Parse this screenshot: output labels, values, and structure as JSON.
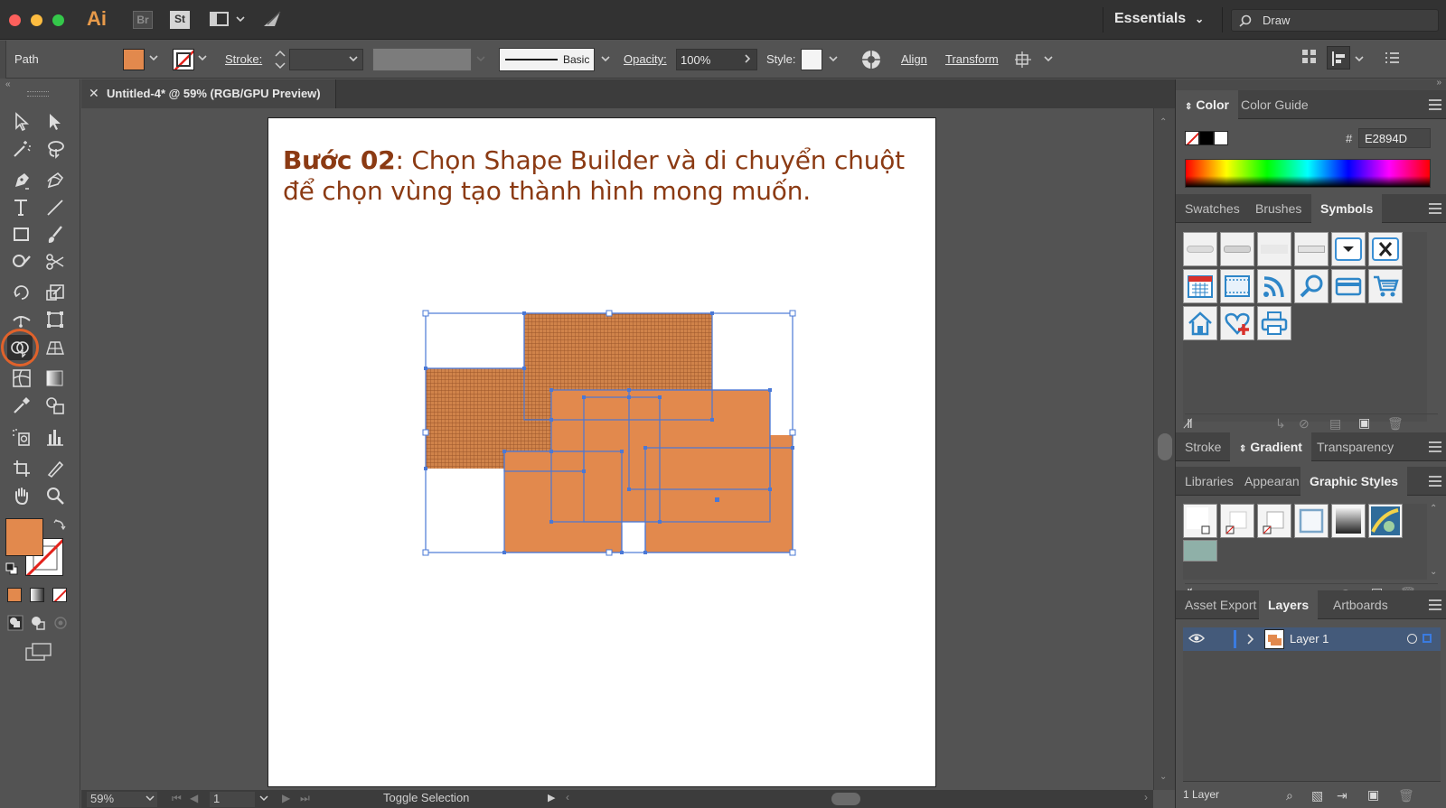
{
  "app": {
    "logo": "Ai",
    "bridge": "Br",
    "stock": "St",
    "workspace": "Essentials",
    "search_placeholder": "Draw"
  },
  "controlbar": {
    "selection_type": "Path",
    "fill_color": "#E2894D",
    "stroke_label": "Stroke:",
    "brush_label": "Basic",
    "opacity_label": "Opacity:",
    "opacity_value": "100%",
    "style_label": "Style:",
    "align_label": "Align",
    "transform_label": "Transform"
  },
  "document": {
    "tab_title": "Untitled-4* @ 59% (RGB/GPU Preview)",
    "heading_bold": "Bước 02",
    "heading_rest": ": Chọn Shape Builder và di chuyển chuột để chọn vùng tạo thành hình mong muốn.",
    "shape_color": "#E2894D",
    "selection_color": "#4a78d6"
  },
  "statusbar": {
    "zoom": "59%",
    "artboard_number": "1",
    "status_text": "Toggle Selection"
  },
  "tools": {
    "active_tool": "shape-builder",
    "highlight_color": "#e0622b"
  },
  "panels": {
    "color": {
      "tabs": [
        "Color",
        "Color Guide"
      ],
      "hex_prefix": "#",
      "hex_value": "E2894D"
    },
    "swatches": {
      "tabs": [
        "Swatches",
        "Brushes",
        "Symbols"
      ],
      "active": "Symbols"
    },
    "stroke": {
      "tabs": [
        "Stroke",
        "Gradient",
        "Transparency"
      ],
      "active": "Gradient"
    },
    "libraries": {
      "tabs": [
        "Libraries",
        "Appearan",
        "Graphic Styles"
      ],
      "active": "Graphic Styles"
    },
    "layers": {
      "tabs": [
        "Asset Export",
        "Layers",
        "Artboards"
      ],
      "active": "Layers",
      "layer_name": "Layer 1",
      "footer_count": "1 Layer"
    }
  }
}
